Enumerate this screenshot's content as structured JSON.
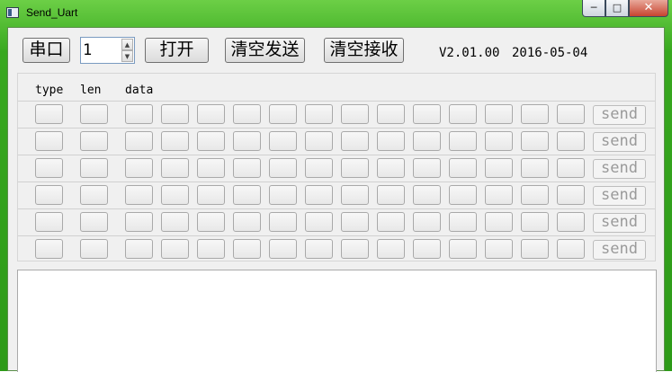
{
  "window": {
    "title": "Send_Uart",
    "icon": "app-window-icon",
    "controls": {
      "minimize": "─",
      "maximize": "□",
      "close": "✕"
    }
  },
  "toolbar": {
    "port_label": "串口",
    "port_value": "1",
    "open_label": "打开",
    "clear_send_label": "清空发送",
    "clear_recv_label": "清空接收",
    "version": "V2.01.00",
    "date": "2016-05-04"
  },
  "grid": {
    "headers": {
      "type": "type",
      "len": "len",
      "data": "data"
    },
    "rows": [
      {
        "send_label": "send"
      },
      {
        "send_label": "send"
      },
      {
        "send_label": "send"
      },
      {
        "send_label": "send"
      },
      {
        "send_label": "send"
      },
      {
        "send_label": "send"
      }
    ]
  },
  "receive": {
    "content": ""
  },
  "colors": {
    "titlebar": "#38a81f",
    "client_bg": "#f0f0f0",
    "send_text_disabled": "#9a9a9a"
  }
}
